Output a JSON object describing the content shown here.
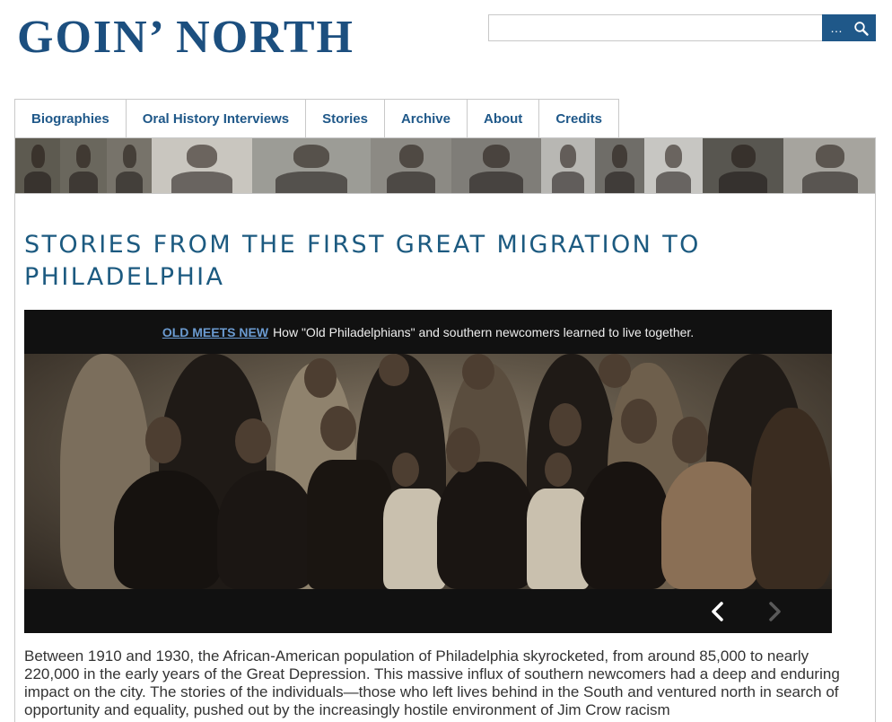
{
  "site": {
    "title": "GOIN’ NORTH"
  },
  "search": {
    "placeholder": "",
    "button_label": "…",
    "icon": "search-icon"
  },
  "nav": {
    "items": [
      {
        "label": "Biographies"
      },
      {
        "label": "Oral History Interviews"
      },
      {
        "label": "Stories"
      },
      {
        "label": "Archive"
      },
      {
        "label": "About"
      },
      {
        "label": "Credits"
      }
    ]
  },
  "header_strip": {
    "photo_count": 12
  },
  "main": {
    "title": "STORIES FROM THE FIRST GREAT MIGRATION TO PHILADELPHIA",
    "slider": {
      "caption_link": "OLD MEETS NEW",
      "caption_text": "How \"Old Philadelphians\" and southern newcomers learned to live together.",
      "prev_icon": "chevron-left-icon",
      "next_icon": "chevron-right-icon"
    },
    "intro": "Between 1910 and 1930, the African-American population of Philadelphia skyrocketed, from around 85,000 to nearly 220,000 in the early years of the Great Depression. This massive influx of southern newcomers had a deep and enduring impact on the city. The stories of the individuals—those who left lives behind in the South and ventured north in search of opportunity and equality, pushed out by the increasingly hostile environment of Jim Crow racism"
  },
  "colors": {
    "brand": "#1c4f7f",
    "link": "#1f5889",
    "title": "#1c5a80",
    "caption_link": "#6b9bd1"
  }
}
